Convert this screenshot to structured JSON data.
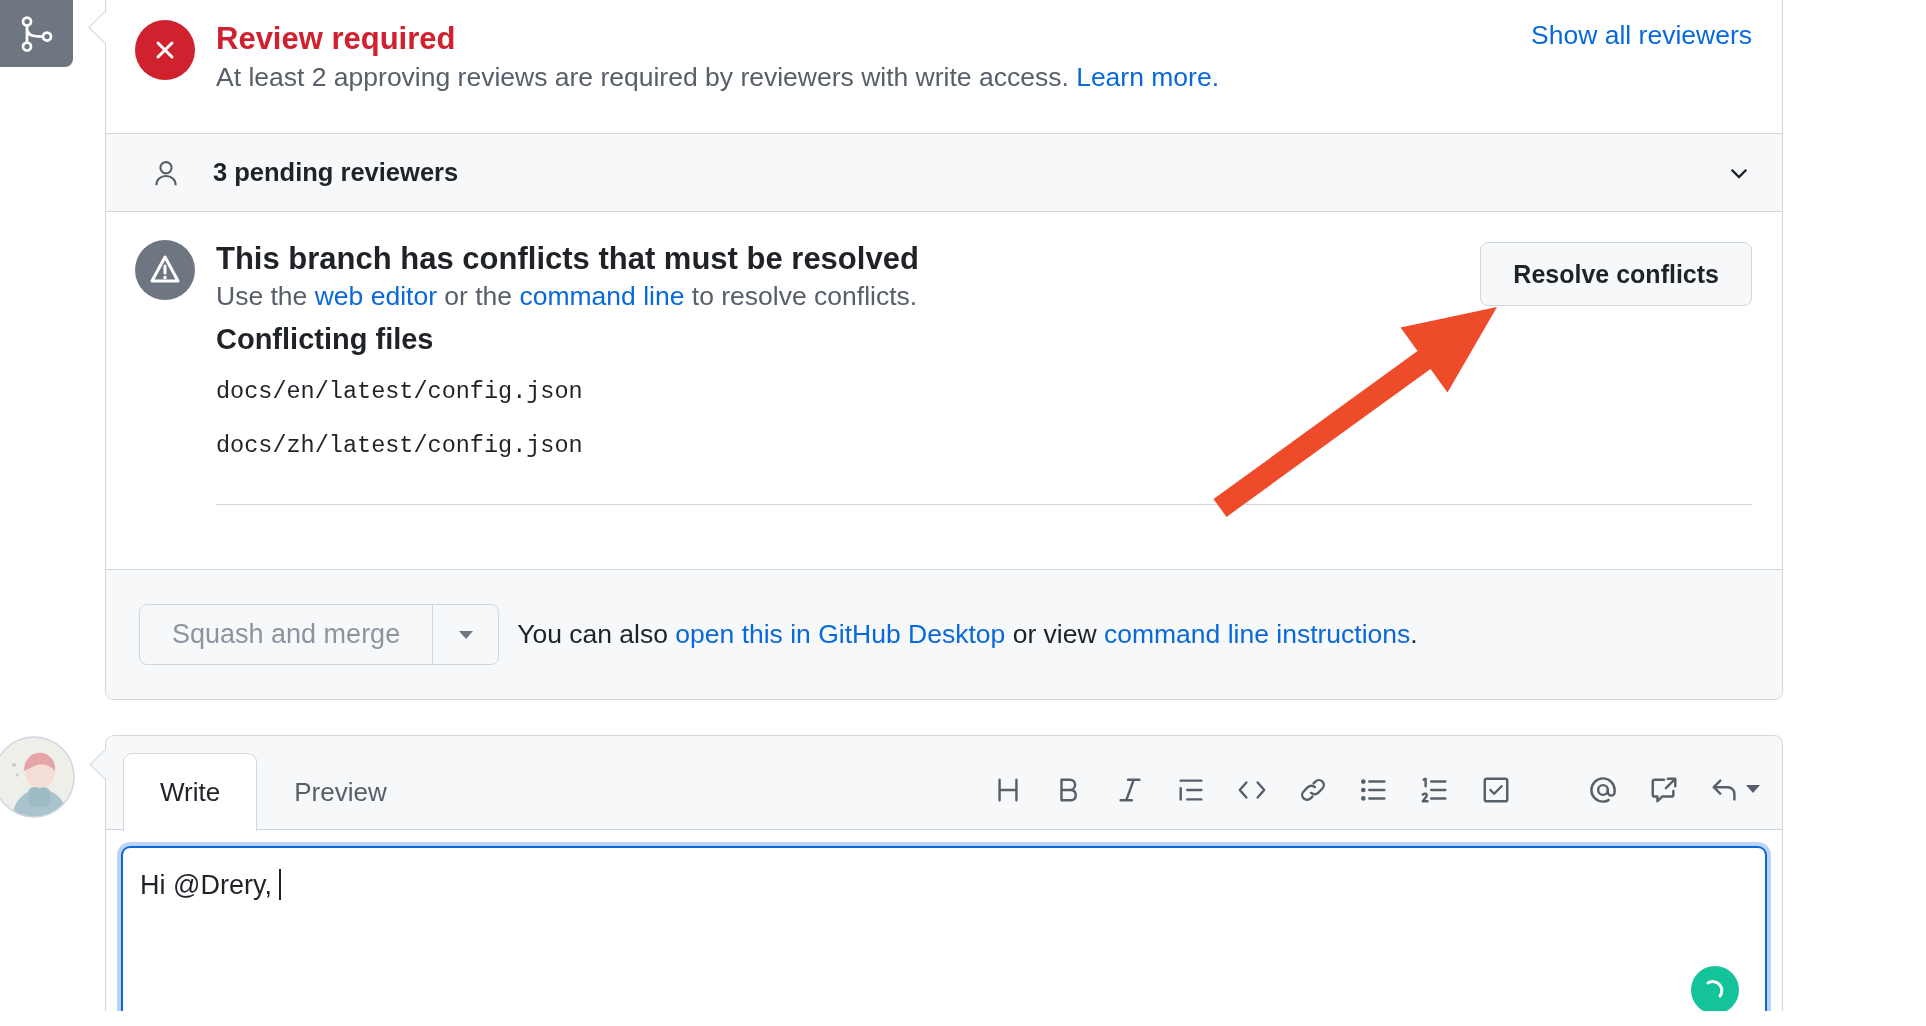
{
  "review": {
    "title": "Review required",
    "description": "At least 2 approving reviews are required by reviewers with write access.",
    "link": "Learn more.",
    "action": "Show all reviewers"
  },
  "pending": {
    "label": "3 pending reviewers",
    "expanded": false
  },
  "conflicts": {
    "title": "This branch has conflicts that must be resolved",
    "description": [
      {
        "kind": "text",
        "text": "Use the "
      },
      {
        "kind": "link",
        "text": "web editor"
      },
      {
        "kind": "text",
        "text": " or the "
      },
      {
        "kind": "link",
        "text": "command line"
      },
      {
        "kind": "text",
        "text": " to resolve conflicts."
      }
    ],
    "files_heading": "Conflicting files",
    "files": [
      "docs/en/latest/config.json",
      "docs/zh/latest/config.json"
    ],
    "button": "Resolve conflicts"
  },
  "merge": {
    "button": "Squash and merge",
    "disabled": true,
    "note": [
      {
        "kind": "text",
        "text": "You can also "
      },
      {
        "kind": "link",
        "text": "open this in GitHub Desktop"
      },
      {
        "kind": "text",
        "text": " or view "
      },
      {
        "kind": "link",
        "text": "command line instructions"
      },
      {
        "kind": "text",
        "text": "."
      }
    ]
  },
  "comment": {
    "tabs": [
      {
        "label": "Write",
        "selected": true
      },
      {
        "label": "Preview",
        "selected": false
      }
    ],
    "value": "Hi @Drery,"
  }
}
